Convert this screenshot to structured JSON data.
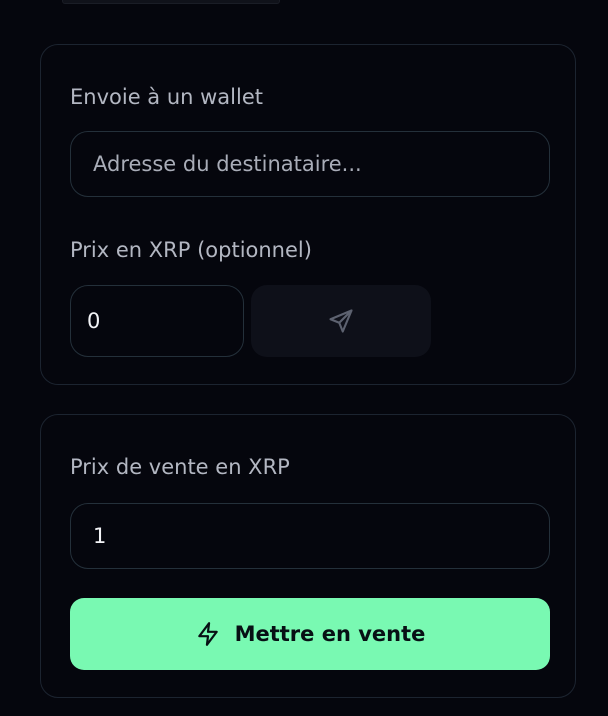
{
  "send_card": {
    "wallet_label": "Envoie à un wallet",
    "recipient_placeholder": "Adresse du destinataire...",
    "recipient_value": "",
    "price_label": "Prix en XRP (optionnel)",
    "price_value": "0",
    "send_icon": "send-icon"
  },
  "sale_card": {
    "price_label": "Prix de vente en XRP",
    "price_value": "1",
    "button_label": "Mettre en vente",
    "button_icon": "lightning-icon"
  },
  "colors": {
    "background": "#05060d",
    "card_border": "#1c2430",
    "accent": "#79f9b2"
  }
}
